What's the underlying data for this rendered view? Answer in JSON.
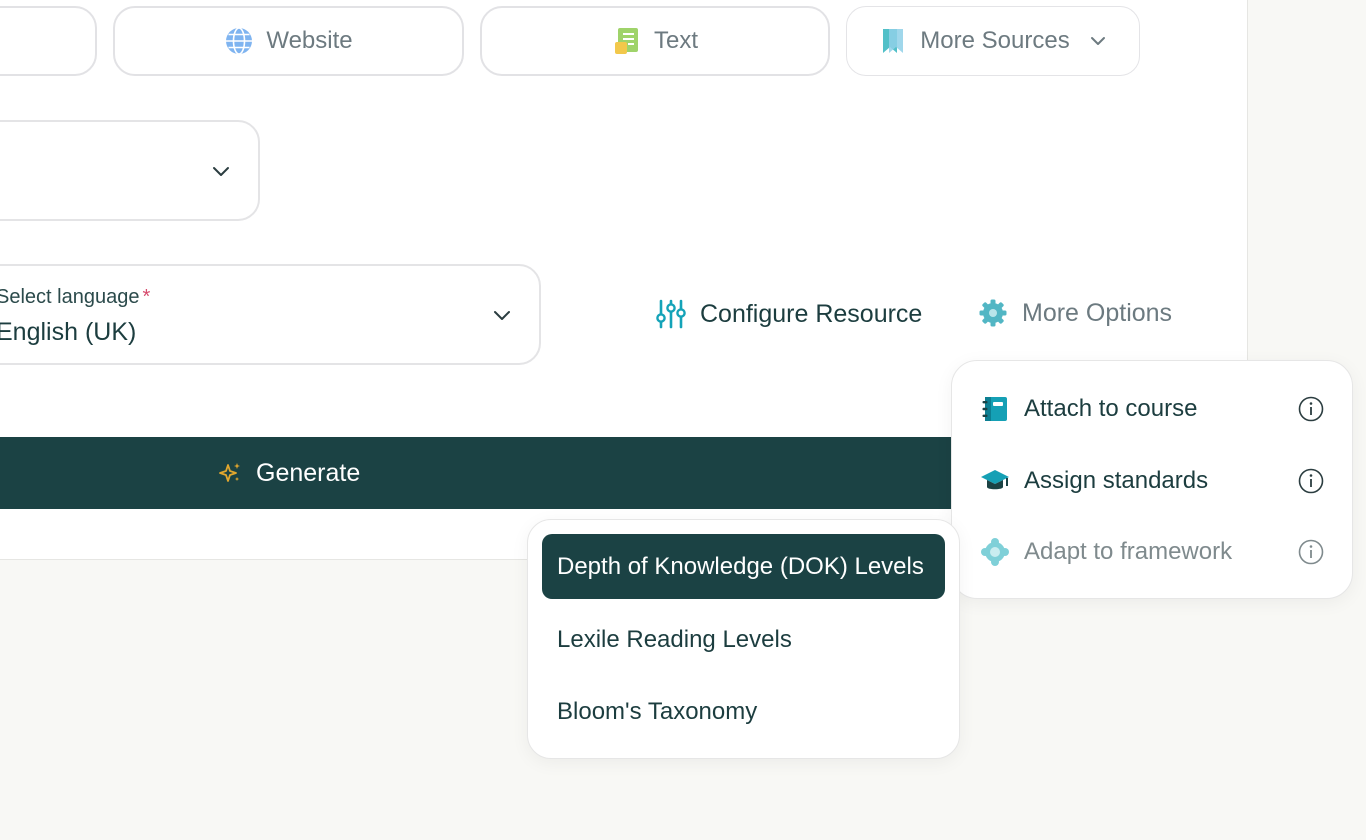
{
  "sources": {
    "website_label": "Website",
    "text_label": "Text",
    "more_label": "More Sources"
  },
  "language": {
    "label": "Select language",
    "required_mark": "*",
    "value": "English (UK)"
  },
  "actions": {
    "configure_label": "Configure Resource",
    "more_options_label": "More Options",
    "generate_label": "Generate"
  },
  "more_options_menu": {
    "items": [
      {
        "label": "Attach to course"
      },
      {
        "label": "Assign standards"
      },
      {
        "label": "Adapt to framework"
      }
    ]
  },
  "framework_menu": {
    "items": [
      {
        "label": "Depth of Knowledge (DOK) Levels",
        "selected": true
      },
      {
        "label": "Lexile Reading Levels"
      },
      {
        "label": "Bloom's Taxonomy"
      }
    ]
  },
  "colors": {
    "primary": "#1b4244",
    "accent_teal": "#14a3b8",
    "spark_gold": "#e2a72e",
    "required_red": "#d64a6c"
  }
}
